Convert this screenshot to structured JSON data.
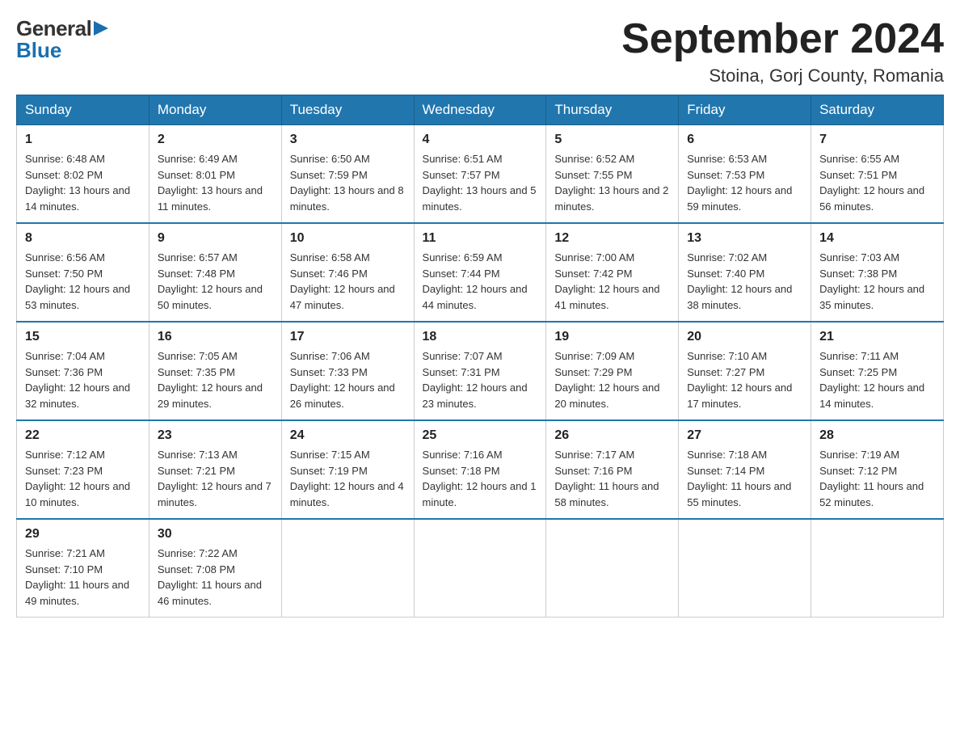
{
  "logo": {
    "general": "General",
    "blue": "Blue"
  },
  "title": "September 2024",
  "subtitle": "Stoina, Gorj County, Romania",
  "days_of_week": [
    "Sunday",
    "Monday",
    "Tuesday",
    "Wednesday",
    "Thursday",
    "Friday",
    "Saturday"
  ],
  "weeks": [
    [
      {
        "day": "1",
        "sunrise": "Sunrise: 6:48 AM",
        "sunset": "Sunset: 8:02 PM",
        "daylight": "Daylight: 13 hours and 14 minutes."
      },
      {
        "day": "2",
        "sunrise": "Sunrise: 6:49 AM",
        "sunset": "Sunset: 8:01 PM",
        "daylight": "Daylight: 13 hours and 11 minutes."
      },
      {
        "day": "3",
        "sunrise": "Sunrise: 6:50 AM",
        "sunset": "Sunset: 7:59 PM",
        "daylight": "Daylight: 13 hours and 8 minutes."
      },
      {
        "day": "4",
        "sunrise": "Sunrise: 6:51 AM",
        "sunset": "Sunset: 7:57 PM",
        "daylight": "Daylight: 13 hours and 5 minutes."
      },
      {
        "day": "5",
        "sunrise": "Sunrise: 6:52 AM",
        "sunset": "Sunset: 7:55 PM",
        "daylight": "Daylight: 13 hours and 2 minutes."
      },
      {
        "day": "6",
        "sunrise": "Sunrise: 6:53 AM",
        "sunset": "Sunset: 7:53 PM",
        "daylight": "Daylight: 12 hours and 59 minutes."
      },
      {
        "day": "7",
        "sunrise": "Sunrise: 6:55 AM",
        "sunset": "Sunset: 7:51 PM",
        "daylight": "Daylight: 12 hours and 56 minutes."
      }
    ],
    [
      {
        "day": "8",
        "sunrise": "Sunrise: 6:56 AM",
        "sunset": "Sunset: 7:50 PM",
        "daylight": "Daylight: 12 hours and 53 minutes."
      },
      {
        "day": "9",
        "sunrise": "Sunrise: 6:57 AM",
        "sunset": "Sunset: 7:48 PM",
        "daylight": "Daylight: 12 hours and 50 minutes."
      },
      {
        "day": "10",
        "sunrise": "Sunrise: 6:58 AM",
        "sunset": "Sunset: 7:46 PM",
        "daylight": "Daylight: 12 hours and 47 minutes."
      },
      {
        "day": "11",
        "sunrise": "Sunrise: 6:59 AM",
        "sunset": "Sunset: 7:44 PM",
        "daylight": "Daylight: 12 hours and 44 minutes."
      },
      {
        "day": "12",
        "sunrise": "Sunrise: 7:00 AM",
        "sunset": "Sunset: 7:42 PM",
        "daylight": "Daylight: 12 hours and 41 minutes."
      },
      {
        "day": "13",
        "sunrise": "Sunrise: 7:02 AM",
        "sunset": "Sunset: 7:40 PM",
        "daylight": "Daylight: 12 hours and 38 minutes."
      },
      {
        "day": "14",
        "sunrise": "Sunrise: 7:03 AM",
        "sunset": "Sunset: 7:38 PM",
        "daylight": "Daylight: 12 hours and 35 minutes."
      }
    ],
    [
      {
        "day": "15",
        "sunrise": "Sunrise: 7:04 AM",
        "sunset": "Sunset: 7:36 PM",
        "daylight": "Daylight: 12 hours and 32 minutes."
      },
      {
        "day": "16",
        "sunrise": "Sunrise: 7:05 AM",
        "sunset": "Sunset: 7:35 PM",
        "daylight": "Daylight: 12 hours and 29 minutes."
      },
      {
        "day": "17",
        "sunrise": "Sunrise: 7:06 AM",
        "sunset": "Sunset: 7:33 PM",
        "daylight": "Daylight: 12 hours and 26 minutes."
      },
      {
        "day": "18",
        "sunrise": "Sunrise: 7:07 AM",
        "sunset": "Sunset: 7:31 PM",
        "daylight": "Daylight: 12 hours and 23 minutes."
      },
      {
        "day": "19",
        "sunrise": "Sunrise: 7:09 AM",
        "sunset": "Sunset: 7:29 PM",
        "daylight": "Daylight: 12 hours and 20 minutes."
      },
      {
        "day": "20",
        "sunrise": "Sunrise: 7:10 AM",
        "sunset": "Sunset: 7:27 PM",
        "daylight": "Daylight: 12 hours and 17 minutes."
      },
      {
        "day": "21",
        "sunrise": "Sunrise: 7:11 AM",
        "sunset": "Sunset: 7:25 PM",
        "daylight": "Daylight: 12 hours and 14 minutes."
      }
    ],
    [
      {
        "day": "22",
        "sunrise": "Sunrise: 7:12 AM",
        "sunset": "Sunset: 7:23 PM",
        "daylight": "Daylight: 12 hours and 10 minutes."
      },
      {
        "day": "23",
        "sunrise": "Sunrise: 7:13 AM",
        "sunset": "Sunset: 7:21 PM",
        "daylight": "Daylight: 12 hours and 7 minutes."
      },
      {
        "day": "24",
        "sunrise": "Sunrise: 7:15 AM",
        "sunset": "Sunset: 7:19 PM",
        "daylight": "Daylight: 12 hours and 4 minutes."
      },
      {
        "day": "25",
        "sunrise": "Sunrise: 7:16 AM",
        "sunset": "Sunset: 7:18 PM",
        "daylight": "Daylight: 12 hours and 1 minute."
      },
      {
        "day": "26",
        "sunrise": "Sunrise: 7:17 AM",
        "sunset": "Sunset: 7:16 PM",
        "daylight": "Daylight: 11 hours and 58 minutes."
      },
      {
        "day": "27",
        "sunrise": "Sunrise: 7:18 AM",
        "sunset": "Sunset: 7:14 PM",
        "daylight": "Daylight: 11 hours and 55 minutes."
      },
      {
        "day": "28",
        "sunrise": "Sunrise: 7:19 AM",
        "sunset": "Sunset: 7:12 PM",
        "daylight": "Daylight: 11 hours and 52 minutes."
      }
    ],
    [
      {
        "day": "29",
        "sunrise": "Sunrise: 7:21 AM",
        "sunset": "Sunset: 7:10 PM",
        "daylight": "Daylight: 11 hours and 49 minutes."
      },
      {
        "day": "30",
        "sunrise": "Sunrise: 7:22 AM",
        "sunset": "Sunset: 7:08 PM",
        "daylight": "Daylight: 11 hours and 46 minutes."
      },
      null,
      null,
      null,
      null,
      null
    ]
  ]
}
